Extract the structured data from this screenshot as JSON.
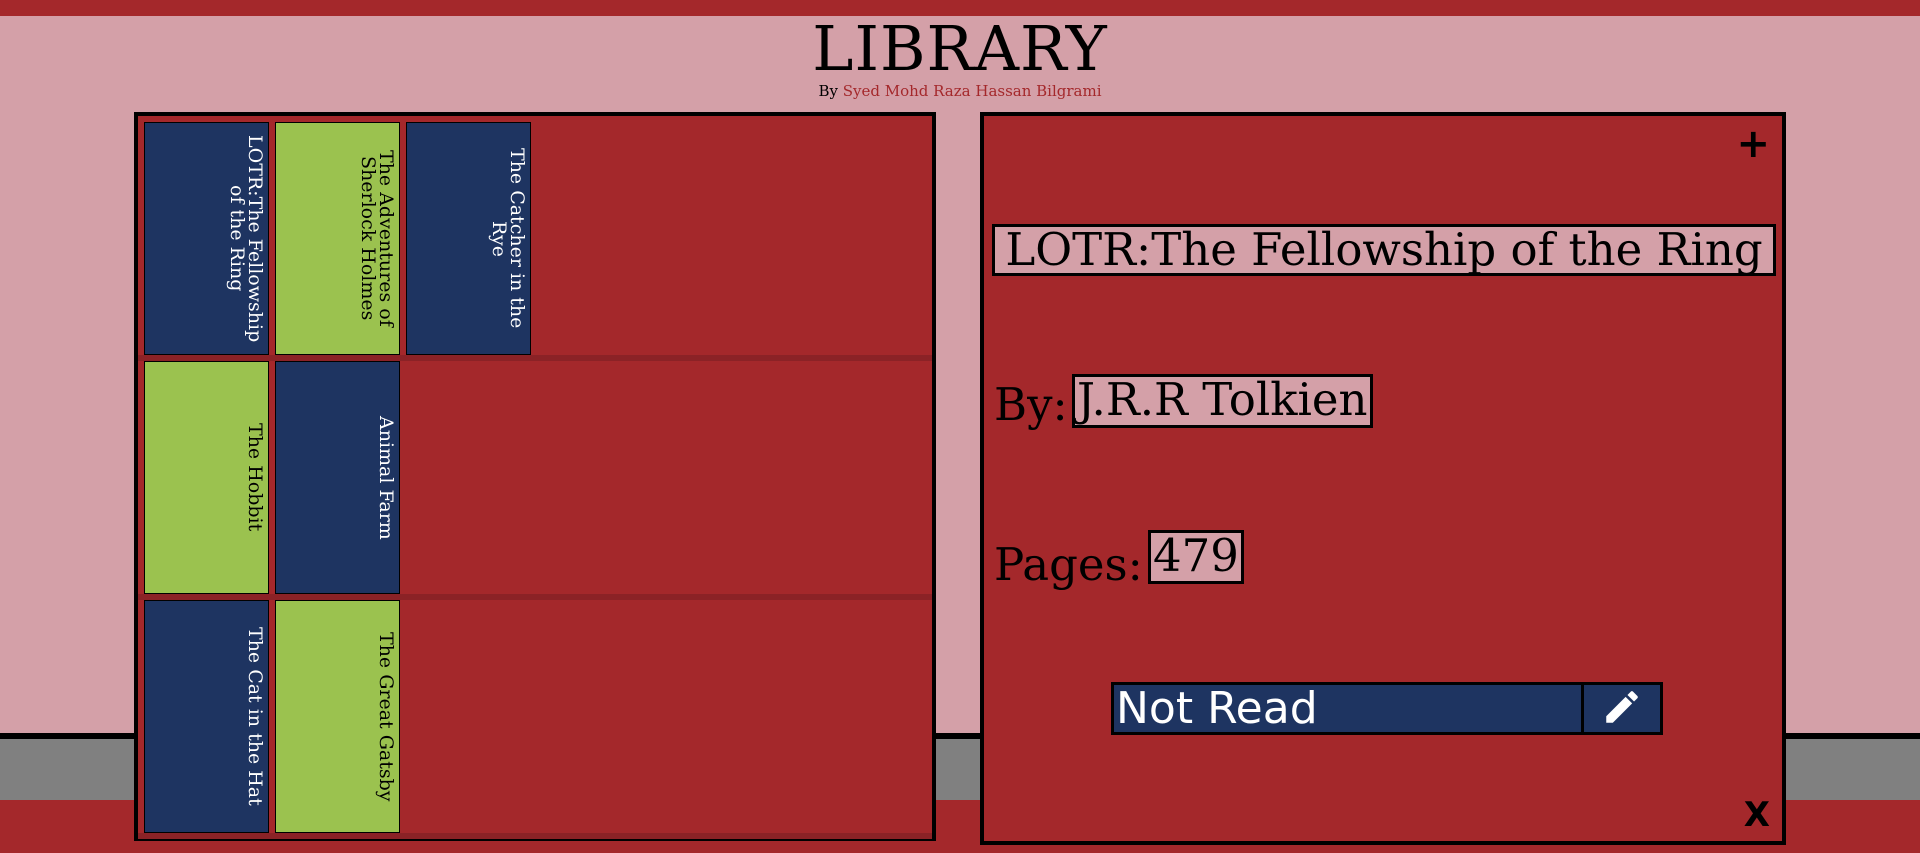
{
  "header": {
    "title": "LIBRARY",
    "by_prefix": "By",
    "author": "Syed Mohd Raza Hassan Bilgrami"
  },
  "shelves": [
    {
      "books": [
        {
          "title": "LOTR:The Fellowship of the Ring",
          "color": "navy"
        },
        {
          "title": "The Adventures of Sherlock Holmes",
          "color": "green"
        },
        {
          "title": "The Catcher in the Rye",
          "color": "navy"
        }
      ]
    },
    {
      "books": [
        {
          "title": "The Hobbit",
          "color": "green"
        },
        {
          "title": "Animal Farm",
          "color": "navy"
        }
      ]
    },
    {
      "books": [
        {
          "title": "The Cat in the Hat",
          "color": "navy"
        },
        {
          "title": "The Great Gatsby",
          "color": "green"
        }
      ]
    }
  ],
  "detail": {
    "add_icon": "+",
    "close_icon": "X",
    "book_title": "LOTR:The Fellowship of the Ring",
    "author_label": "By:",
    "author": "J.R.R Tolkien",
    "pages_label": "Pages:",
    "pages": "479",
    "status": "Not Read",
    "edit_icon": "pencil-icon"
  },
  "colors": {
    "background": "#d4a0a8",
    "accent_red": "#a4282b",
    "navy": "#1e3461",
    "green": "#9bc24f",
    "floor_gray": "#808080"
  }
}
